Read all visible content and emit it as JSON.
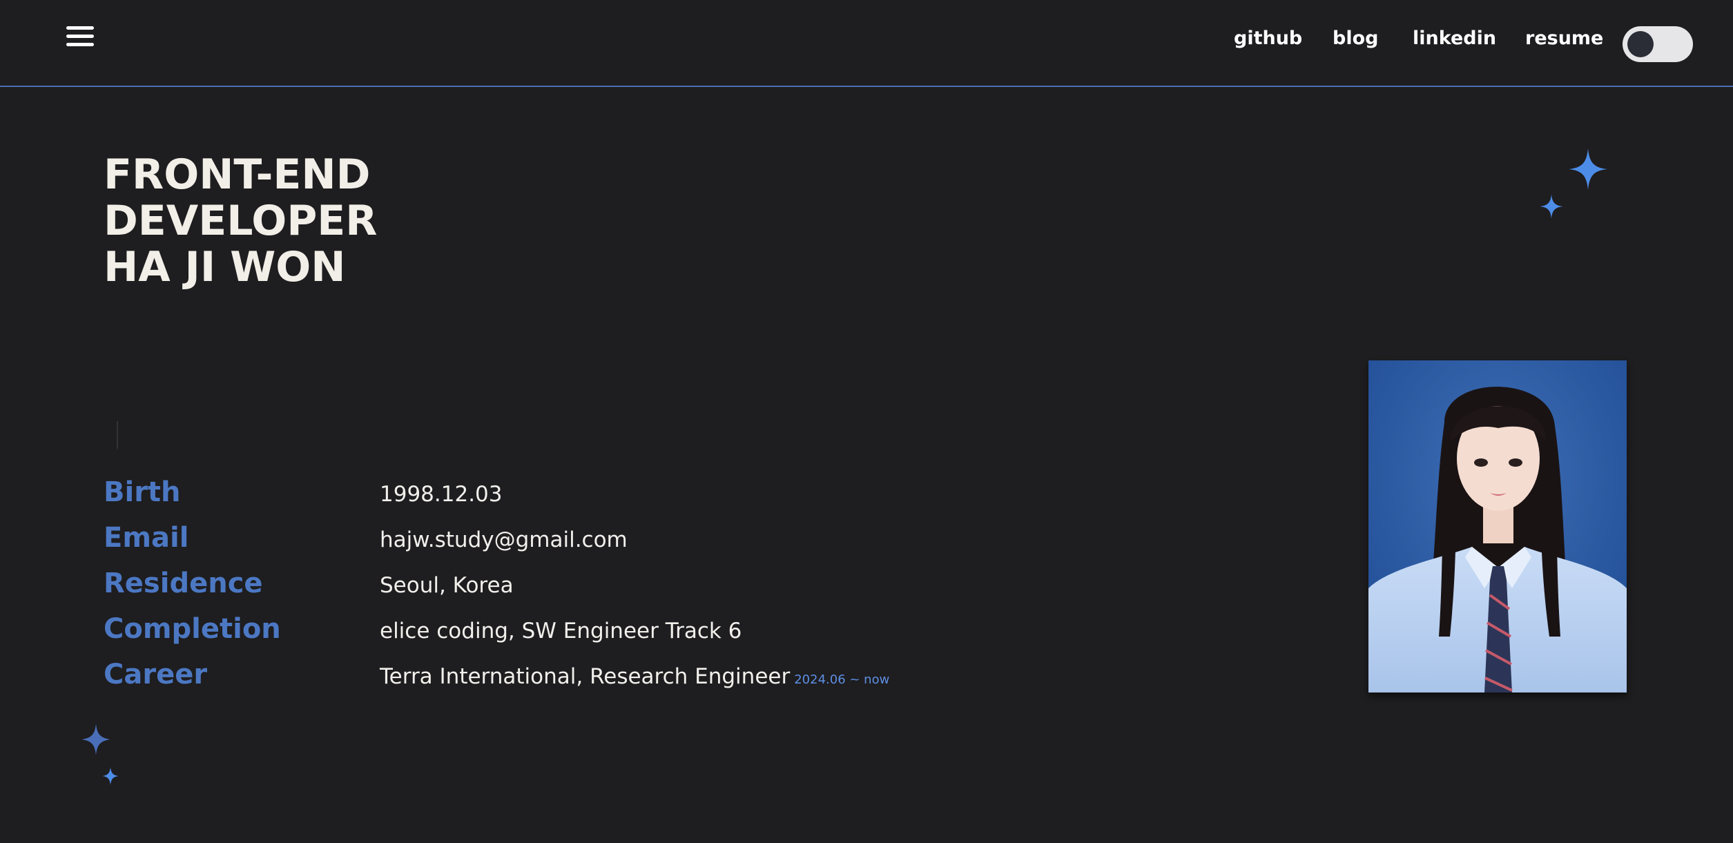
{
  "header": {
    "menu_icon": "hamburger-menu-icon",
    "nav": [
      {
        "label": "github"
      },
      {
        "label": "blog"
      },
      {
        "label": "linkedin"
      },
      {
        "label": "resume"
      }
    ],
    "theme_toggle": {
      "state": "off",
      "icon": "toggle-switch"
    }
  },
  "hero": {
    "title_lines": [
      "FRONT-END",
      "DEVELOPER",
      "HA JI WON"
    ]
  },
  "info": [
    {
      "label": "Birth",
      "value": "1998.12.03"
    },
    {
      "label": "Email",
      "value": "hajw.study@gmail.com"
    },
    {
      "label": "Residence",
      "value": "Seoul, Korea"
    },
    {
      "label": "Completion",
      "value": "elice coding, SW Engineer Track 6"
    },
    {
      "label": "Career",
      "value": "Terra International, Research Engineer",
      "period": "2024.06 ~ now"
    }
  ],
  "profile_photo": {
    "icon": "profile-photo"
  },
  "colors": {
    "background": "#1e1d1f",
    "accent": "#4c78c3",
    "sparkle": "#4d8de8",
    "header_border": "#4a6fb8",
    "text": "#f2f0ec"
  }
}
